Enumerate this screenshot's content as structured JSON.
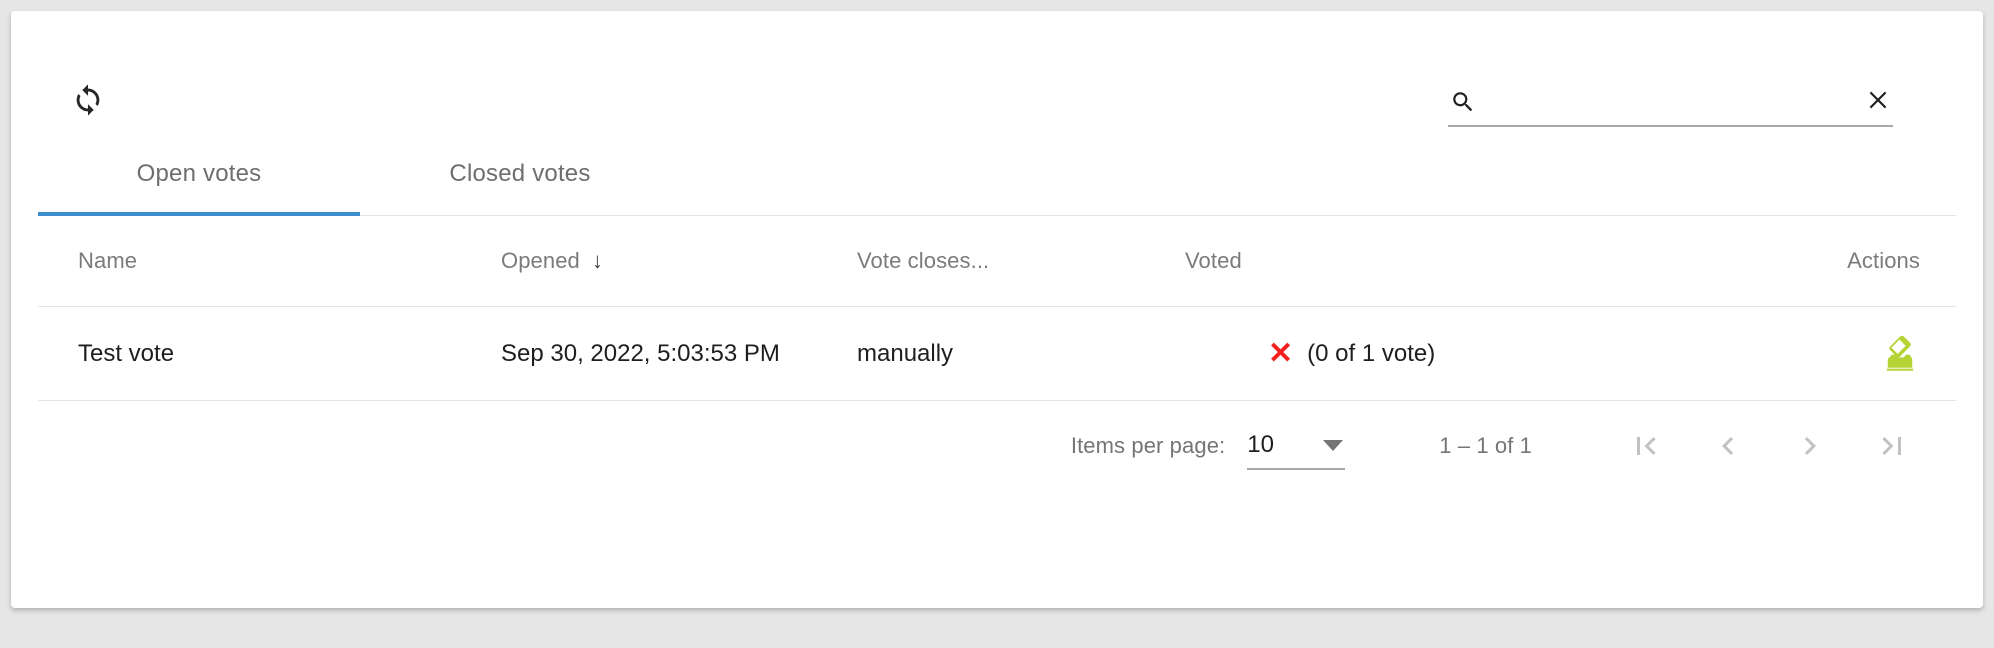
{
  "toolbar": {
    "refresh_icon": "refresh-icon",
    "search": {
      "icon": "search-icon",
      "value": "",
      "placeholder": "",
      "clear_icon": "close-icon"
    }
  },
  "tabs": [
    {
      "label": "Open votes",
      "active": true
    },
    {
      "label": "Closed votes",
      "active": false
    }
  ],
  "table": {
    "columns": [
      {
        "label": "Name",
        "sortable": true
      },
      {
        "label": "Opened",
        "sortable": true,
        "sort_direction": "desc",
        "sort_glyph": "↓"
      },
      {
        "label": "Vote closes...",
        "sortable": true
      },
      {
        "label": "Voted",
        "sortable": false
      },
      {
        "label": "Actions",
        "sortable": false
      }
    ],
    "rows": [
      {
        "name": "Test vote",
        "opened": "Sep 30, 2022, 5:03:53 PM",
        "vote_closes": "manually",
        "voted_icon": "x-mark-icon",
        "voted_glyph": "✕",
        "voted_count": "(0 of 1 vote)",
        "action_icon": "how-to-vote-icon"
      }
    ]
  },
  "paginator": {
    "items_per_page_label": "Items per page:",
    "items_per_page_value": "10",
    "items_per_page_options": [
      "10"
    ],
    "range_label": "1 – 1 of 1",
    "buttons": [
      {
        "name": "first-page-button",
        "icon": "first-page-icon",
        "disabled": true
      },
      {
        "name": "previous-page-button",
        "icon": "chevron-left-icon",
        "disabled": true
      },
      {
        "name": "next-page-button",
        "icon": "chevron-right-icon",
        "disabled": true
      },
      {
        "name": "last-page-button",
        "icon": "last-page-icon",
        "disabled": true
      }
    ]
  },
  "colors": {
    "page_background": "#e6e6e6",
    "card_background": "#ffffff",
    "accent_blue": "#3d8ecc",
    "action_green": "#b5d334",
    "error_red": "#f3201e",
    "muted_text": "#757575",
    "divider": "#e4e4e4"
  }
}
